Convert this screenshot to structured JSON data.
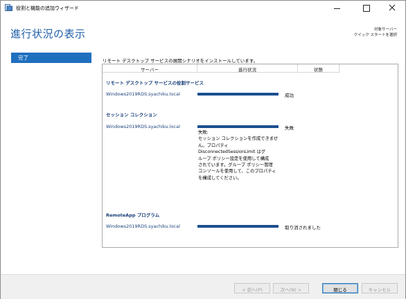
{
  "window": {
    "title": "役割と機能の追加ウィザード",
    "controls": {
      "minimize": "minimize-icon",
      "maximize": "maximize-icon",
      "close": "close-icon"
    }
  },
  "header": {
    "title": "進行状況の表示",
    "target_server_label": "対象サーバー",
    "target_server_value": "クイック スタートを選択"
  },
  "nav": {
    "items": [
      {
        "label": "完了",
        "selected": true
      }
    ]
  },
  "main": {
    "intro": "リモート デスクトップ サービスの展開シナリオをインストールしています。",
    "columns": {
      "server": "サーバー",
      "progress": "進行状況",
      "status": "状態"
    },
    "sections": [
      {
        "title": "リモート デスクトップ サービスの役割サービス",
        "server": "Windows2019RDS.syachiku.local",
        "progress": 1.0,
        "status": "成功"
      },
      {
        "title": "セッション コレクション",
        "server": "Windows2019RDS.syachiku.local",
        "progress": 1.0,
        "status": "失敗",
        "detail_lines": [
          "失敗:",
          "セッション コレクションを作成できませ",
          "ん。プロパティ",
          "DisconnectedSessionLimit はグ",
          "ループ ポリシー設定を使用して構成",
          "されています。グループ ポリシー管理",
          "コンソールを使用して、このプロパティ",
          "を構成してください。"
        ]
      },
      {
        "title": "RemoteApp プログラム",
        "server": "Windows2019RDS.syachiku.local",
        "progress": 1.0,
        "status": "取り消されました"
      }
    ]
  },
  "buttons": {
    "prev": "< 前へ(P)",
    "next": "次へ(N) >",
    "close": "閉じる",
    "cancel": "キャンセル"
  },
  "colors": {
    "accent": "#1f6fbf",
    "title": "#1f5fa8",
    "bar": "#1a4f8f"
  }
}
